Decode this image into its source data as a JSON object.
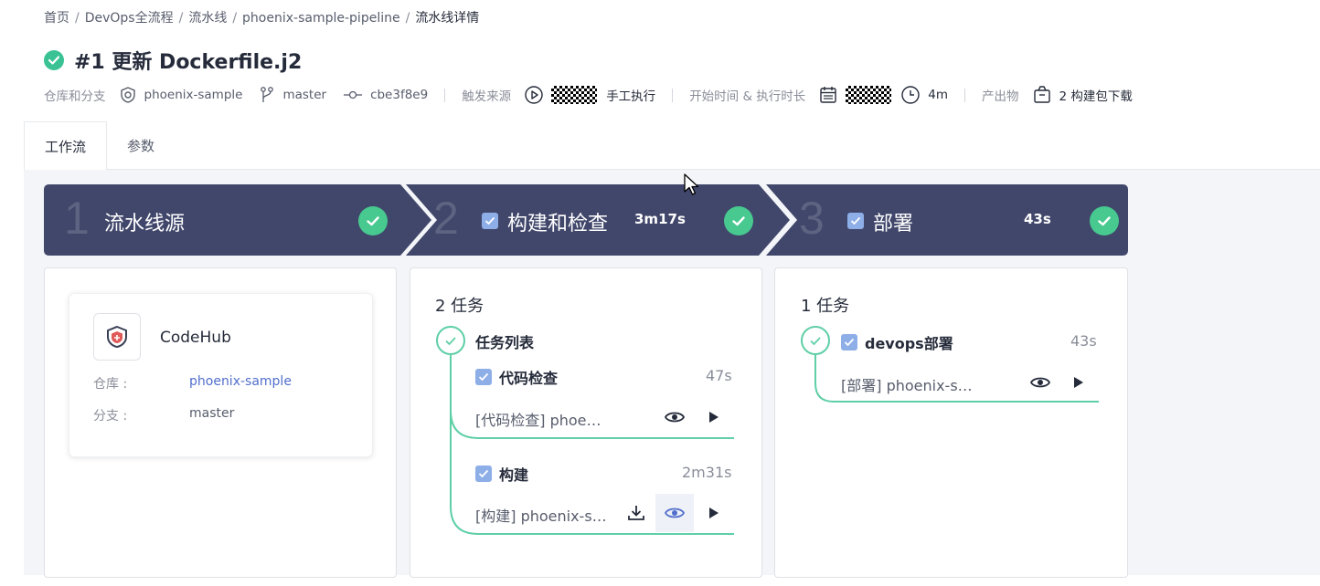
{
  "breadcrumb": {
    "items": [
      "首页",
      "DevOps全流程",
      "流水线",
      "phoenix-sample-pipeline"
    ],
    "current": "流水线详情",
    "separator": "/"
  },
  "header": {
    "title": "#1 更新 Dockerfile.j2",
    "status": "success"
  },
  "meta": {
    "repo_label": "仓库和分支",
    "repo": "phoenix-sample",
    "branch": "master",
    "commit": "cbe3f8e9",
    "trigger_label": "触发来源",
    "trigger": "手工执行",
    "time_label": "开始时间 & 执行时长",
    "duration": "4m",
    "artifact_label": "产出物",
    "artifact": "2 构建包下载"
  },
  "tabs": [
    {
      "label": "工作流",
      "active": true
    },
    {
      "label": "参数",
      "active": false
    }
  ],
  "stages": [
    {
      "num": "1",
      "name": "流水线源",
      "duration": "",
      "checkbox": false
    },
    {
      "num": "2",
      "name": "构建和检查",
      "duration": "3m17s",
      "checkbox": true
    },
    {
      "num": "3",
      "name": "部署",
      "duration": "43s",
      "checkbox": true
    }
  ],
  "source_card": {
    "name": "CodeHub",
    "repo_key": "仓库 :",
    "repo_value": "phoenix-sample",
    "branch_key": "分支 :",
    "branch_value": "master"
  },
  "stage2": {
    "count": "2 任务",
    "group": "任务列表",
    "jobs": [
      {
        "name": "代码检查",
        "duration": "47s",
        "desc": "[代码检查] phoe…"
      },
      {
        "name": "构建",
        "duration": "2m31s",
        "desc": "[构建] phoenix-s…"
      }
    ]
  },
  "stage3": {
    "count": "1 任务",
    "jobs": [
      {
        "name": "devops部署",
        "duration": "43s",
        "desc": "[部署] phoenix-s…"
      }
    ]
  },
  "colors": {
    "stage_bar": "#41476b",
    "success": "#3ac295",
    "flow_line": "#5ecfa6",
    "checkbox": "#8eaee8",
    "link": "#526ecc"
  },
  "icons": [
    "check-circle-icon",
    "repo-icon",
    "branch-icon",
    "commit-icon",
    "play-icon",
    "calendar-icon",
    "clock-icon",
    "package-icon",
    "checkbox-icon",
    "eye-icon",
    "run-icon",
    "download-icon",
    "codehub-logo-icon",
    "cursor-icon"
  ]
}
